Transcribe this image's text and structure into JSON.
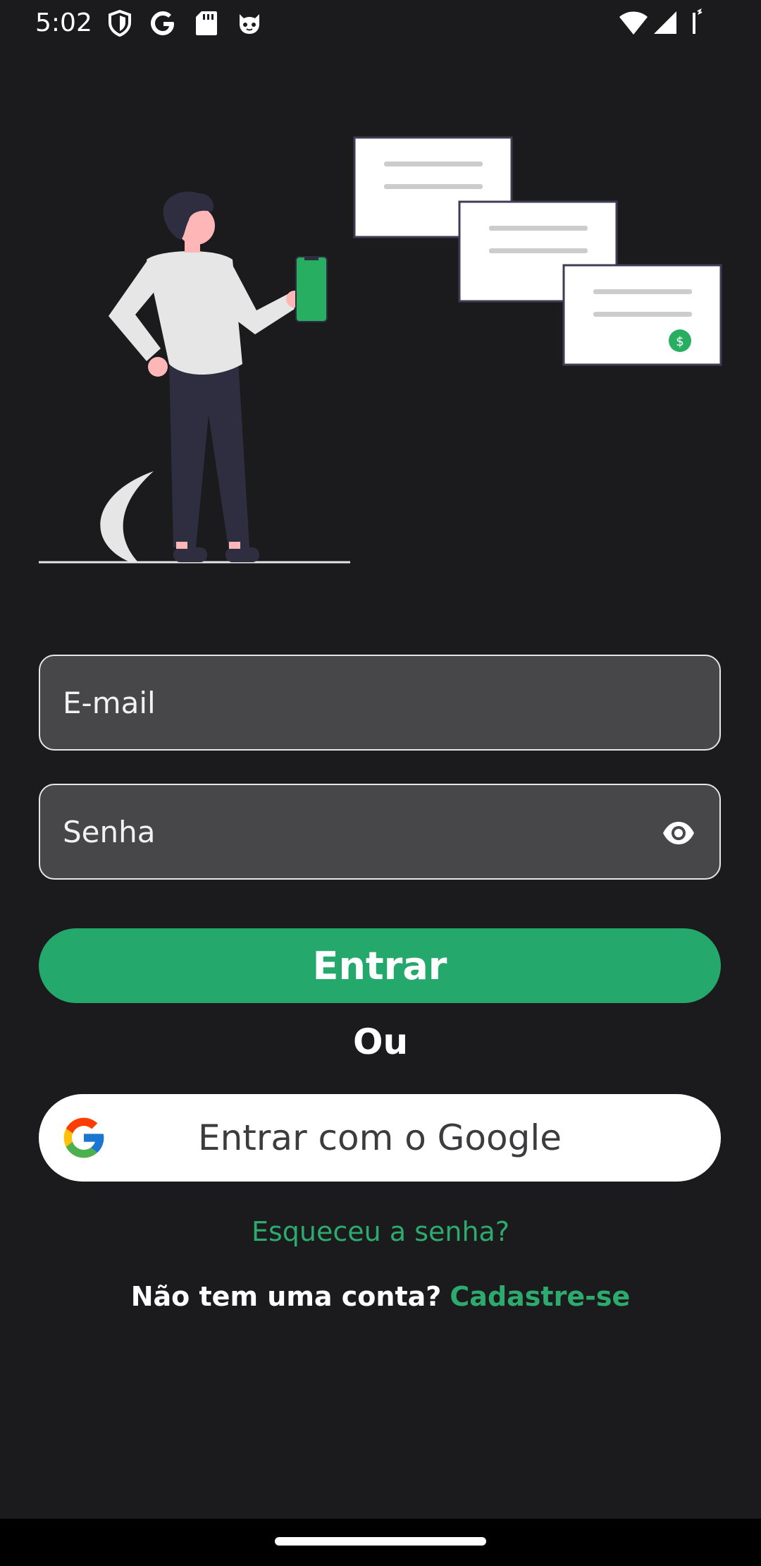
{
  "status_bar": {
    "time": "5:02",
    "left_icons": [
      "shield-icon",
      "google-g-icon",
      "sd-card-icon",
      "cat-face-icon"
    ],
    "right_icons": [
      "wifi-icon",
      "cellular-signal-icon",
      "battery-icon"
    ]
  },
  "illustration": {
    "name": "person-with-phone-and-payment-cards",
    "accent_color": "#27ae60",
    "cards": [
      "$",
      "$",
      "$"
    ]
  },
  "login_form": {
    "email_placeholder": "E-mail",
    "password_placeholder": "Senha",
    "password_toggle_icon": "eye-icon",
    "login_button_label": "Entrar",
    "divider_text": "Ou",
    "google_button_label": "Entrar com o Google",
    "google_icon": "google-logo-icon",
    "forgot_password_label": "Esqueceu a senha?",
    "signup_prompt": "Não tem uma conta?",
    "signup_link_label": "Cadastre-se"
  },
  "colors": {
    "background": "#1b1b1d",
    "accent": "#24a86b",
    "link": "#2dab6e",
    "field_background": "#474749"
  }
}
